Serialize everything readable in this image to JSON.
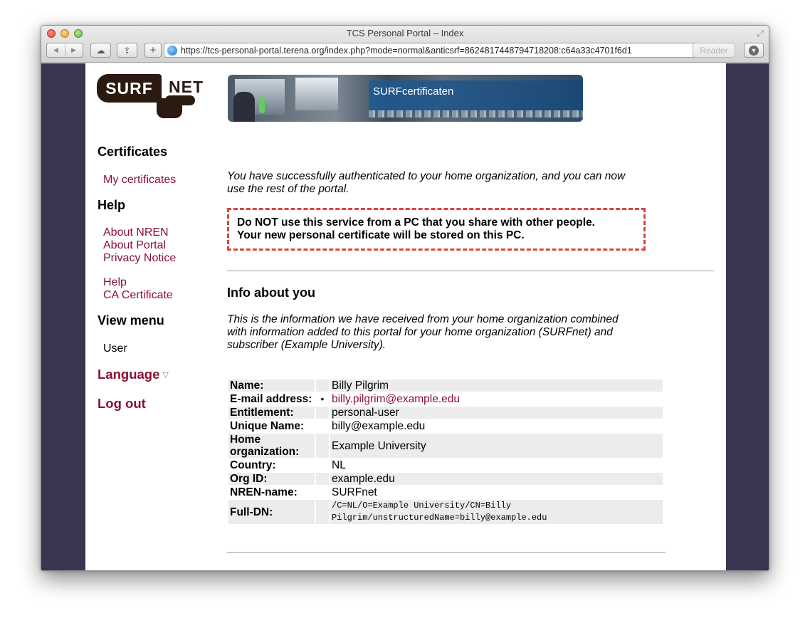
{
  "window": {
    "title": "TCS Personal Portal – Index",
    "url": "https://tcs-personal-portal.terena.org/index.php?mode=normal&anticsrf=8624817448794718208:c64a33c4701f6d1",
    "reader_label": "Reader"
  },
  "header": {
    "logo_left": "SURF",
    "logo_right": "NET",
    "banner_title": "SURFcertificaten"
  },
  "sidebar": {
    "certificates_heading": "Certificates",
    "my_certificates": "My certificates",
    "help_heading": "Help",
    "about_nren": "About NREN",
    "about_portal": "About Portal",
    "privacy_notice": "Privacy Notice",
    "help_link": "Help",
    "ca_certificate": "CA Certificate",
    "view_menu_heading": "View menu",
    "user_item": "User",
    "language": "Language",
    "logout": "Log out"
  },
  "main": {
    "intro": "You have successfully authenticated to your home organization, and you can now use the rest of the portal.",
    "warning_line1": "Do NOT use this service from a PC that you share with other people.",
    "warning_line2": "Your new personal certificate will be stored on this PC.",
    "info_heading": "Info about you",
    "info_desc": "This is the information we have received from your home organization combined with information added to this portal for your home organization (SURFnet) and subscriber (Example University).",
    "rows": [
      {
        "label": "Name:",
        "value": "Billy Pilgrim"
      },
      {
        "label": "E-mail address:",
        "bullet": "•",
        "value": "billy.pilgrim@example.edu"
      },
      {
        "label": "Entitlement:",
        "value": "personal-user"
      },
      {
        "label": "Unique Name:",
        "value": "billy@example.edu"
      },
      {
        "label": "Home organization:",
        "value": "Example University"
      },
      {
        "label": "Country:",
        "value": "NL"
      },
      {
        "label": "Org ID:",
        "value": "example.edu"
      },
      {
        "label": "NREN-name:",
        "value": "SURFnet"
      },
      {
        "label": "Full-DN:",
        "value": "/C=NL/O=Example University/CN=Billy Pilgrim/unstructuredName=billy@example.edu"
      }
    ]
  },
  "icons": {
    "back": "back-arrow-icon",
    "forward": "forward-arrow-icon",
    "cloud": "icloud-icon",
    "share": "share-icon",
    "add": "plus-icon",
    "globe": "globe-icon",
    "reload": "reload-icon",
    "download": "download-icon",
    "language_toggle": "triangle-down-icon"
  },
  "colors": {
    "link": "#8a1032",
    "warning_border": "#d9453c",
    "background": "#3a3550"
  }
}
